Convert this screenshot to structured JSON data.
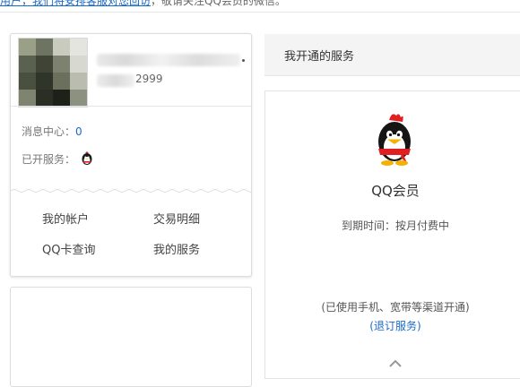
{
  "top_notice": {
    "link_text": "用户，我们将安排客服对您回访",
    "rest_text": "，敬请关注QQ会员的微信。"
  },
  "profile": {
    "qq_suffix": "2999",
    "msg_center_label": "消息中心：",
    "msg_center_count": "0",
    "services_label": "已开服务：",
    "services_icon": "qq-penguin-icon"
  },
  "menu": {
    "my_account": "我的帐户",
    "transactions": "交易明细",
    "qq_card": "QQ卡查询",
    "my_services": "我的服务"
  },
  "panel": {
    "title": "我开通的服务"
  },
  "service": {
    "icon": "qq-penguin-icon",
    "name": "QQ会员",
    "expire_label": "到期时间：",
    "expire_value": "按月付费中",
    "note": "(已使用手机、宽带等渠道开通)",
    "unsub_open": "(",
    "unsub_link": "退订服务",
    "unsub_close": ")"
  },
  "colors": {
    "link": "#1a6ac8",
    "penguin_red": "#e02020"
  }
}
